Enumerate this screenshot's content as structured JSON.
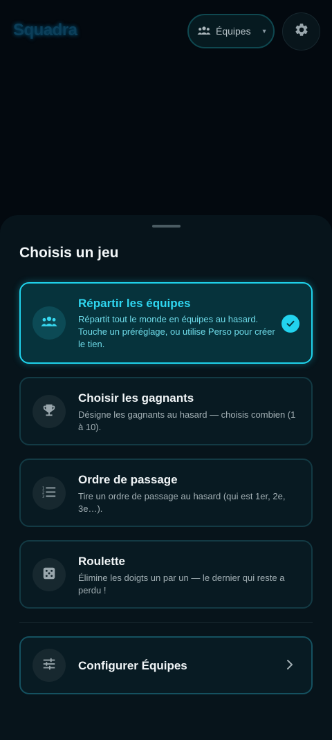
{
  "app": {
    "brand": "Squadra"
  },
  "header": {
    "mode_selector": {
      "label": "Équipes",
      "icon": "groups-icon"
    },
    "settings": {
      "icon": "gear-icon"
    }
  },
  "sheet": {
    "title": "Choisis un jeu",
    "games": [
      {
        "title": "Répartir les équipes",
        "description": "Répartit tout le monde en équipes au hasard. Touche un préréglage, ou utilise Perso pour créer le tien.",
        "icon": "groups-icon",
        "selected": true
      },
      {
        "title": "Choisir les gagnants",
        "description": "Désigne les gagnants au hasard — choisis combien (1 à 10).",
        "icon": "trophy-icon",
        "selected": false
      },
      {
        "title": "Ordre de passage",
        "description": "Tire un ordre de passage au hasard (qui est 1er, 2e, 3e…).",
        "icon": "ordered-list-icon",
        "selected": false
      },
      {
        "title": "Roulette",
        "description": "Élimine les doigts un par un — le dernier qui reste a perdu !",
        "icon": "dice-icon",
        "selected": false
      }
    ],
    "configure": {
      "label": "Configurer Équipes",
      "icon": "sliders-icon"
    }
  },
  "colors": {
    "accent": "#22d3ee",
    "background": "#03090f",
    "card": "#081a22",
    "selected_card": "#06333c"
  }
}
